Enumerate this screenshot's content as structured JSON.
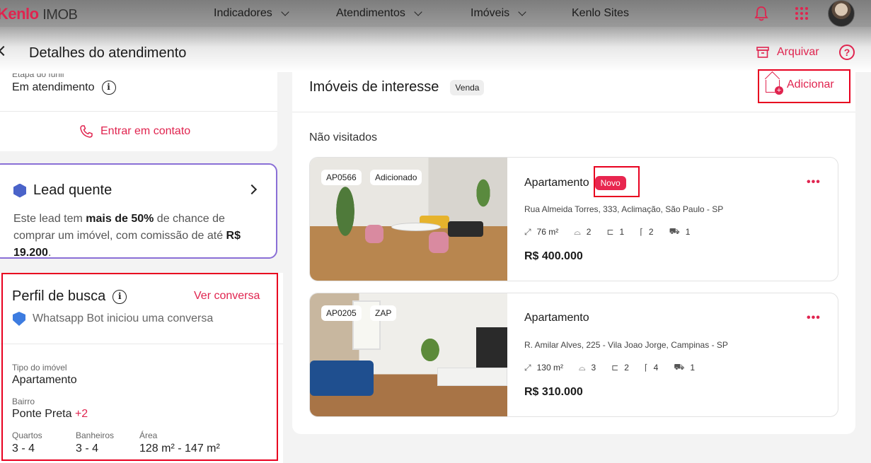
{
  "nav": {
    "logo_brand": "Kenlo",
    "logo_suffix": "IMOB",
    "items": [
      "Indicadores",
      "Atendimentos",
      "Imóveis",
      "Kenlo Sites"
    ]
  },
  "header": {
    "title": "Detalhes do atendimento",
    "archive_label": "Arquivar",
    "help": "?"
  },
  "stage": {
    "label": "Etapa do funil",
    "value": "Em atendimento",
    "info": "i"
  },
  "contact_label": "Entrar em contato",
  "lead": {
    "title": "Lead quente",
    "text_1": "Este lead tem ",
    "text_bold_1": "mais de 50%",
    "text_2": " de chance de comprar um imóvel, com comissão de até ",
    "text_bold_2": "R$ 19.200",
    "text_3": "."
  },
  "profile": {
    "title": "Perfil de busca",
    "info": "i",
    "link": "Ver conversa",
    "bot_text": "Whatsapp Bot iniciou uma conversa",
    "type_label": "Tipo do imóvel",
    "type_value": "Apartamento",
    "bairro_label": "Bairro",
    "bairro_value": "Ponte Preta",
    "bairro_more": "+2",
    "quartos_label": "Quartos",
    "quartos_value": "3 - 4",
    "banheiros_label": "Banheiros",
    "banheiros_value": "3 - 4",
    "area_label": "Área",
    "area_value": "128 m² - 147 m²"
  },
  "panel": {
    "title": "Imóveis de interesse",
    "chip": "Venda",
    "add_label": "Adicionar",
    "section": "Não visitados"
  },
  "properties": [
    {
      "code": "AP0566",
      "tag": "Adicionado",
      "type": "Apartamento",
      "badge": "Novo",
      "address": "Rua Almeida Torres, 333, Aclimação, São Paulo - SP",
      "area": "76 m²",
      "bedrooms": "2",
      "bathrooms": "1",
      "suites": "2",
      "parking": "1",
      "price": "R$ 400.000"
    },
    {
      "code": "AP0205",
      "tag": "ZAP",
      "type": "Apartamento",
      "address": "R. Amilar Alves, 225 - Vila Joao Jorge, Campinas - SP",
      "area": "130 m²",
      "bedrooms": "3",
      "bathrooms": "2",
      "suites": "4",
      "parking": "1",
      "price": "R$ 310.000"
    }
  ],
  "icons": {
    "more": "•••",
    "area": "⤢",
    "bed": "⌓",
    "bath": "⊏",
    "suite": "⌈",
    "car": "⛟"
  },
  "colors": {
    "accent": "#e0244f",
    "highlight_box": "#e8001f",
    "lead_border": "#8a6fd6"
  }
}
